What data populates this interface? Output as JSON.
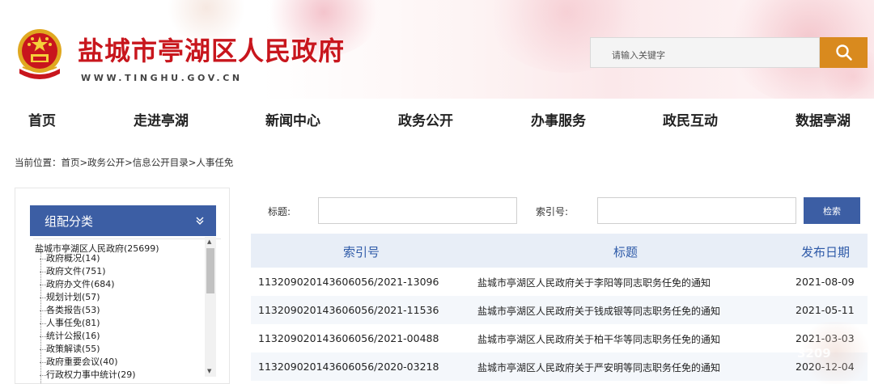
{
  "header": {
    "site_title": "盐城市亭湖区人民政府",
    "site_url": "WWW.TINGHU.GOV.CN",
    "search_placeholder": "请输入关键字",
    "search_icon": "search-icon",
    "accent_color": "#d98a1e",
    "title_color": "#c8161d"
  },
  "nav": {
    "items": [
      "首页",
      "走进亭湖",
      "新闻中心",
      "政务公开",
      "办事服务",
      "政民互动",
      "数据亭湖"
    ]
  },
  "breadcrumb": {
    "text": "当前位置：首页>政务公开>信息公开目录>人事任免"
  },
  "sidebar": {
    "header": "组配分类",
    "header_icon": "double-chevron-down-icon",
    "root": "盐城市亭湖区人民政府(25699)",
    "items": [
      "政府概况(14)",
      "政府文件(751)",
      "政府办文件(684)",
      "规划计划(57)",
      "各类报告(53)",
      "人事任免(81)",
      "统计公报(16)",
      "政策解读(55)",
      "政府重要会议(40)",
      "行政权力事中统计(29)"
    ]
  },
  "filter": {
    "title_label": "标题:",
    "index_label": "索引号:",
    "search_button": "检索"
  },
  "table": {
    "headers": [
      "索引号",
      "标题",
      "发布日期"
    ],
    "rows": [
      {
        "index": "113209020143606056/2021-13096",
        "title": "盐城市亭湖区人民政府关于李阳等同志职务任免的通知",
        "date": "2021-08-09"
      },
      {
        "index": "113209020143606056/2021-11536",
        "title": "盐城市亭湖区人民政府关于钱成银等同志职务任免的通知",
        "date": "2021-05-11"
      },
      {
        "index": "113209020143606056/2021-00488",
        "title": "盐城市亭湖区人民政府关于柏干华等同志职务任免的通知",
        "date": "2021-03-03"
      },
      {
        "index": "113209020143606056/2020-03218",
        "title": "盐城市亭湖区人民政府关于严安明等同志职务任免的通知",
        "date": "2020-12-04"
      }
    ],
    "header_color": "#2e5aa8"
  },
  "watermark": {
    "text": "3209"
  }
}
